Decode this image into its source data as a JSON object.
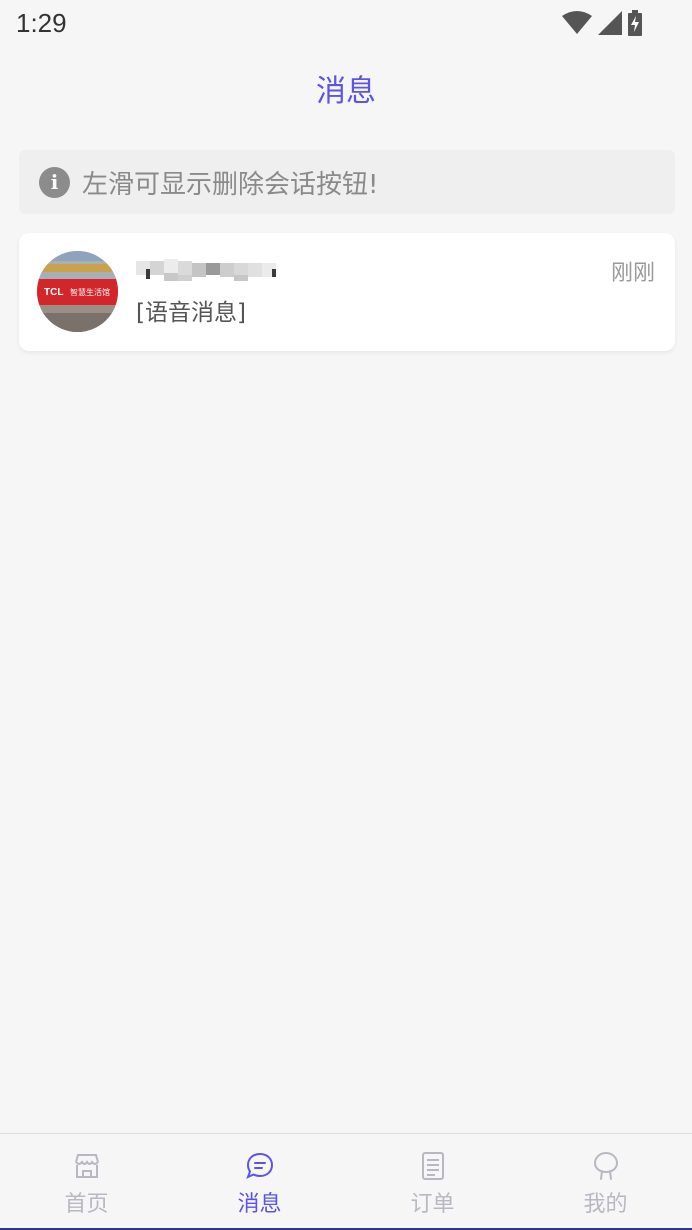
{
  "status_bar": {
    "time": "1:29"
  },
  "header": {
    "title": "消息"
  },
  "tip": {
    "icon": "info-icon",
    "text": "左滑可显示删除会话按钮!"
  },
  "conversations": [
    {
      "name": "",
      "time": "刚刚",
      "last_message": "[语音消息]",
      "avatar_sign_text": "TCL 智慧生活馆"
    }
  ],
  "tabbar": {
    "tabs": [
      {
        "label": "首页",
        "icon": "store-icon",
        "active": false
      },
      {
        "label": "消息",
        "icon": "chat-bubble-icon",
        "active": true
      },
      {
        "label": "订单",
        "icon": "document-icon",
        "active": false
      },
      {
        "label": "我的",
        "icon": "profile-icon",
        "active": false
      }
    ]
  },
  "colors": {
    "accent": "#5b54e8",
    "inactive": "#b7b8c2",
    "background": "#f6f6f6"
  }
}
